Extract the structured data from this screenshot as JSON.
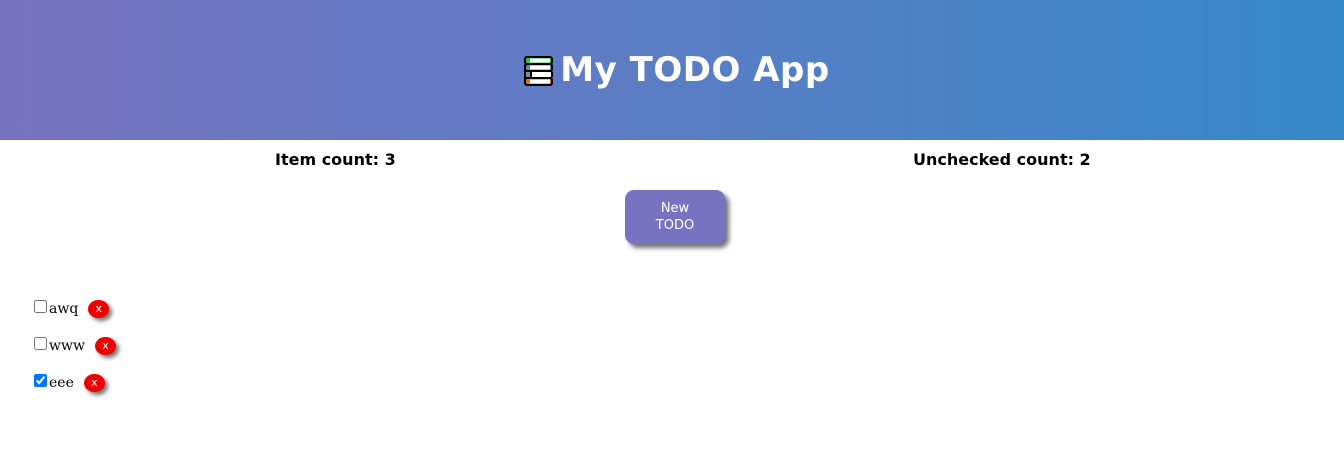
{
  "header": {
    "icon": "books-icon",
    "title": "My TODO App",
    "background_start": "#7873c0",
    "background_end": "#3589c9"
  },
  "counts": {
    "item_count": "Item count: 3",
    "unchecked_count": "Unchecked count: 2"
  },
  "new_todo_button": {
    "label": "New TODO",
    "color": "#7873c0"
  },
  "todos": [
    {
      "text": "awq",
      "checked": false,
      "delete_label": "x"
    },
    {
      "text": "www",
      "checked": false,
      "delete_label": "x"
    },
    {
      "text": "eee",
      "checked": true,
      "delete_label": "x"
    }
  ],
  "delete_color": "#ee0000"
}
